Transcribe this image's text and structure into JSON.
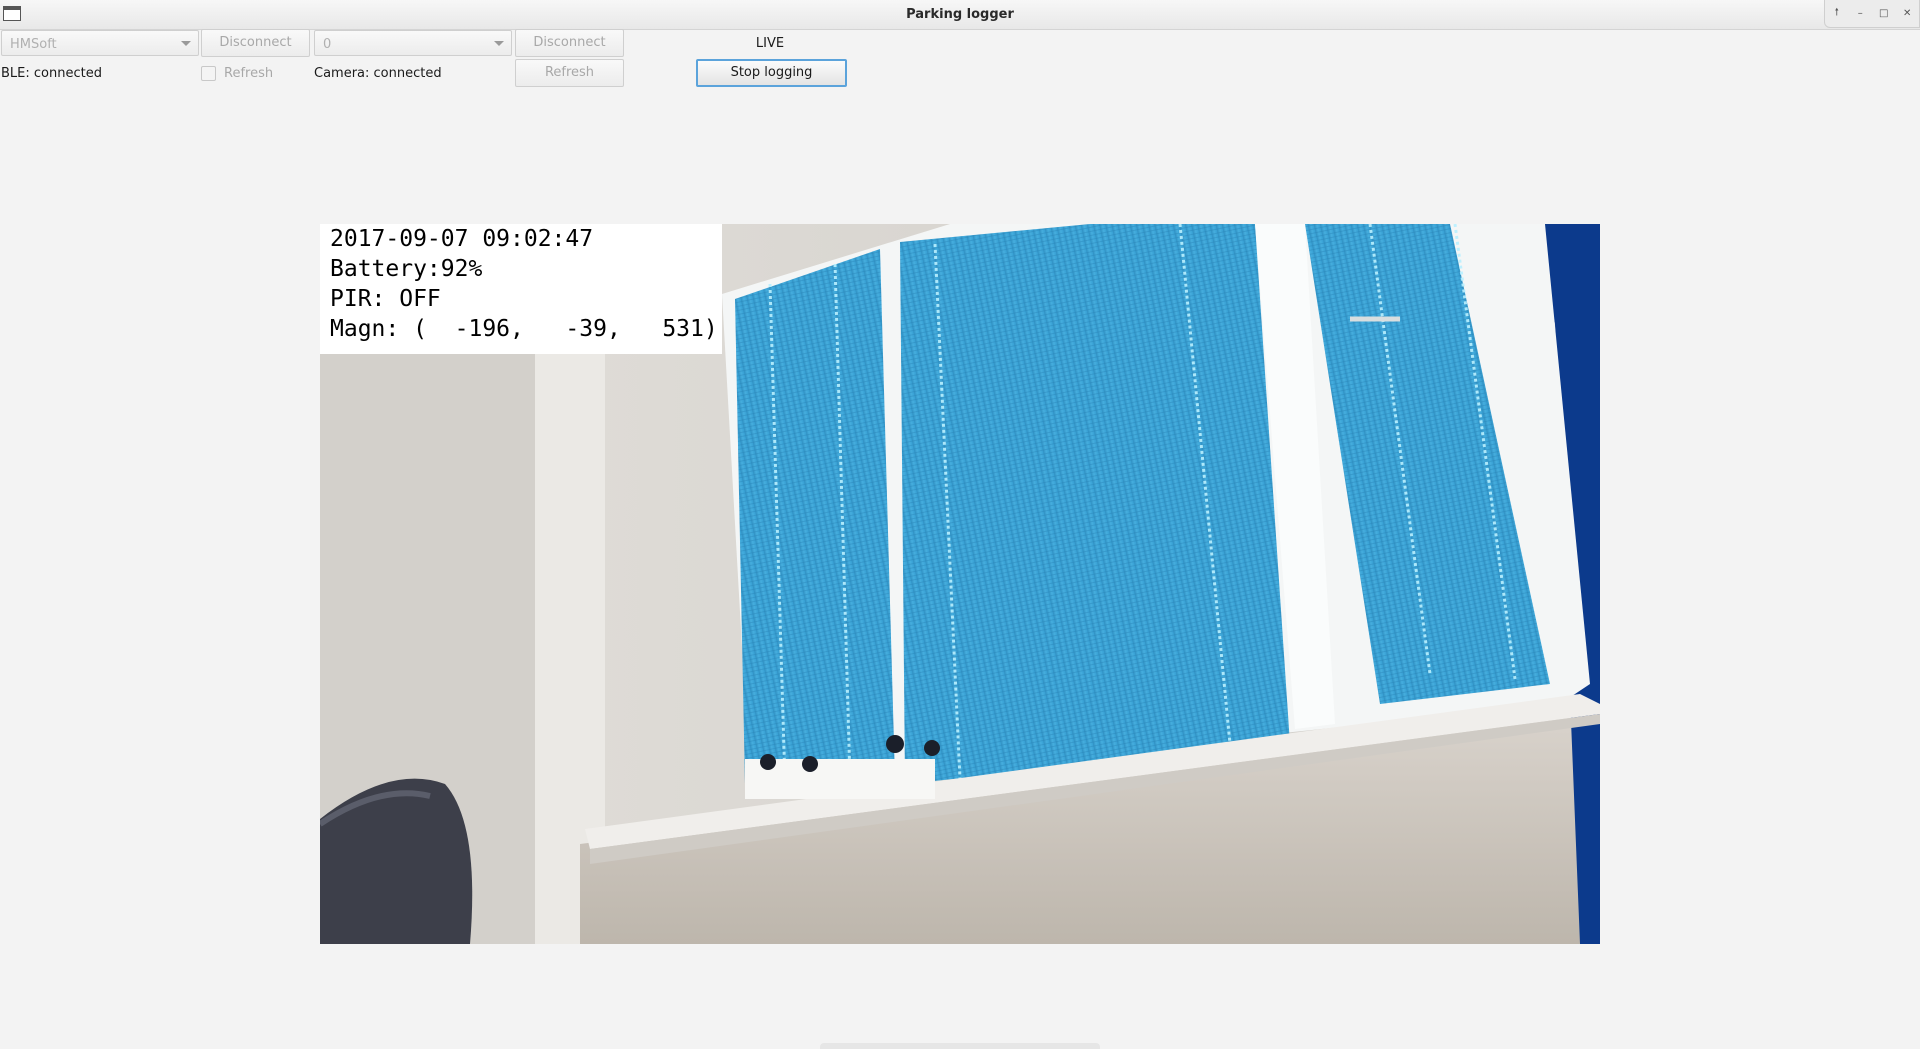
{
  "window": {
    "title": "Parking logger",
    "controls": [
      "restore-icon",
      "minimize-icon",
      "maximize-icon",
      "close-icon"
    ]
  },
  "ble": {
    "device_select": "HMSoft",
    "disconnect_label": "Disconnect",
    "status": "BLE: connected",
    "refresh_label": "Refresh",
    "refresh_checked": false
  },
  "camera_ctrl": {
    "device_select": "0",
    "disconnect_label": "Disconnect",
    "status": "Camera: connected",
    "refresh_label": "Refresh"
  },
  "logging": {
    "mode_label": "LIVE",
    "stop_label": "Stop logging"
  },
  "feed": {
    "timestamp": "2017-09-07 09:02:47",
    "battery": "Battery:92%",
    "pir": "PIR: OFF",
    "magn": "Magn: (  -196,   -39,   531)"
  },
  "colors": {
    "accent_border": "#5ba3db",
    "blinds": "#3a9fd1",
    "window_bg": "#f3f3f3"
  }
}
